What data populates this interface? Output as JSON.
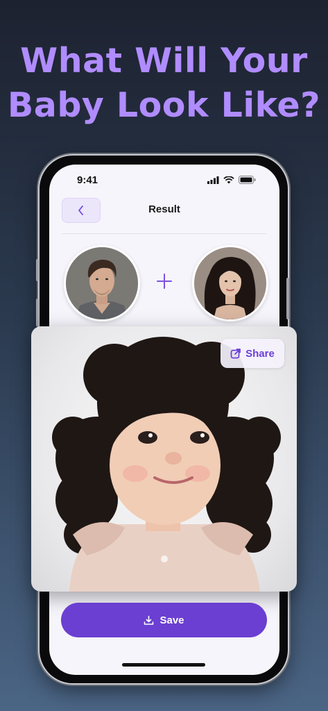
{
  "headline": {
    "line1": "What Will Your",
    "line2": "Baby Look Like?"
  },
  "status_bar": {
    "time": "9:41"
  },
  "nav": {
    "title": "Result",
    "back_icon": "chevron-left-icon"
  },
  "parents": {
    "father_photo": "father-photo",
    "mother_photo": "mother-photo",
    "plus_icon": "plus-icon"
  },
  "result": {
    "image": "baby-result-photo",
    "share_label": "Share",
    "share_icon": "share-icon"
  },
  "actions": {
    "save_label": "Save",
    "save_icon": "download-icon"
  },
  "colors": {
    "accent": "#6b3fd1",
    "headline": "#b08cff",
    "screen_bg": "#f6f5fb"
  }
}
